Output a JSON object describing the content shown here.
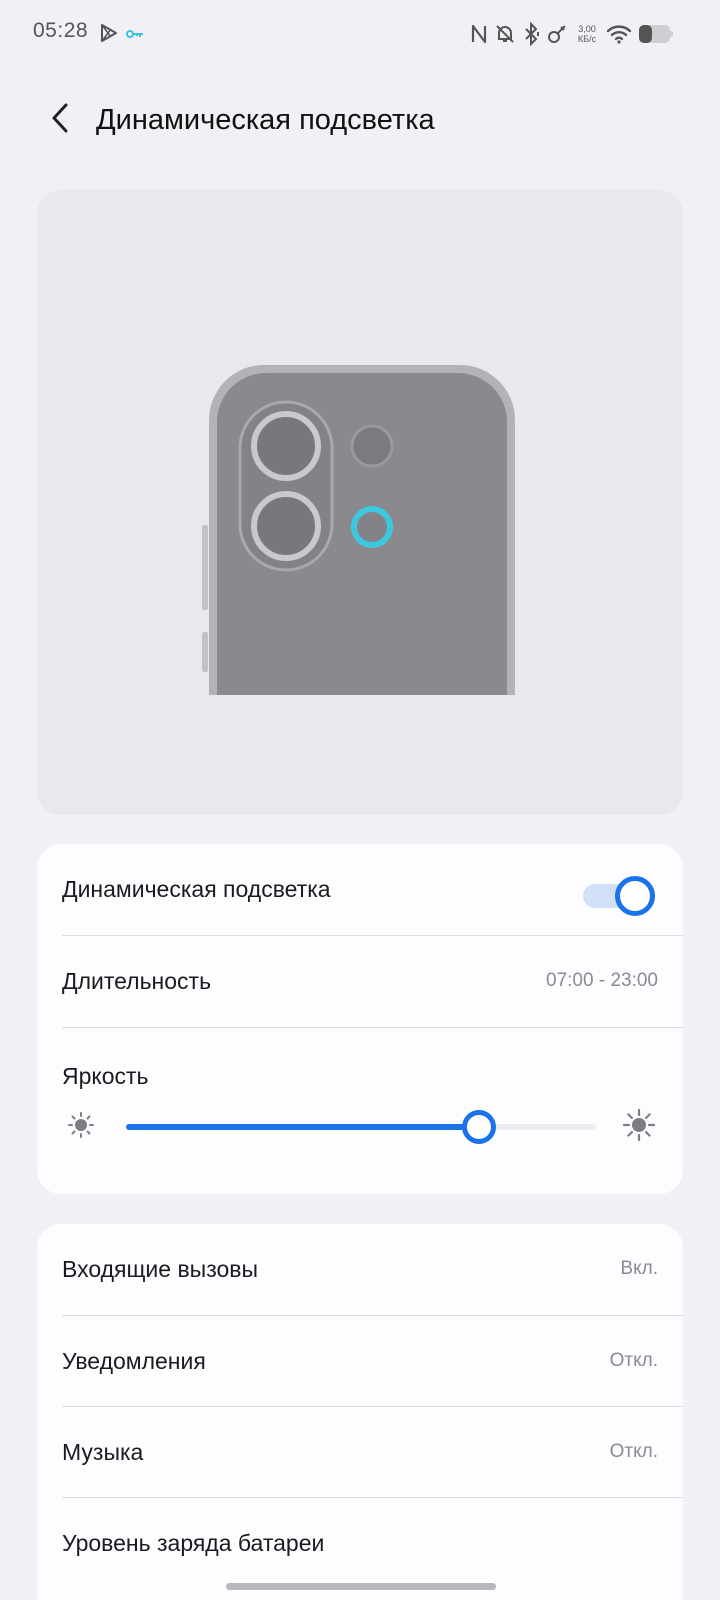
{
  "status_bar": {
    "time": "05:28",
    "speed_value": "3,00",
    "speed_unit": "КБ/с",
    "icons": [
      "play-store-icon",
      "key-icon",
      "nfc-icon",
      "bell-off-icon",
      "bluetooth-icon",
      "satellite-icon",
      "wifi-icon",
      "battery-icon"
    ],
    "key_color": "#39c4dc"
  },
  "header": {
    "back_icon": "chevron-left-icon",
    "title": "Динамическая подсветка"
  },
  "preview": {
    "light_ring_color": "#3ec8e0"
  },
  "settings": {
    "toggle_row": {
      "label": "Динамическая подсветка",
      "enabled": true
    },
    "duration_row": {
      "label": "Длительность",
      "value": "07:00 - 23:00"
    },
    "brightness": {
      "label": "Яркость",
      "level_percent": 75
    }
  },
  "triggers": [
    {
      "label": "Входящие вызовы",
      "value": "Вкл."
    },
    {
      "label": "Уведомления",
      "value": "Откл."
    },
    {
      "label": "Музыка",
      "value": "Откл."
    },
    {
      "label": "Уровень заряда батареи",
      "value": ""
    }
  ],
  "colors": {
    "accent": "#1a73e8",
    "background": "#f1f0f5",
    "card": "#fdfdff"
  }
}
